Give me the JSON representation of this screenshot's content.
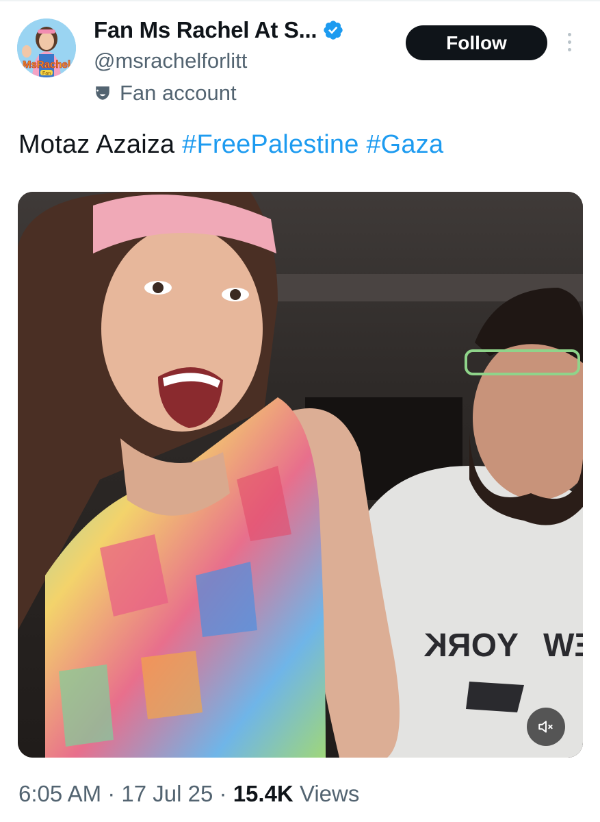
{
  "author": {
    "display_name": "Fan Ms Rachel At S...",
    "handle": "@msrachelforlitt",
    "label": "Fan account",
    "avatar_text": "MsRachel",
    "avatar_subtext": "Fan",
    "verified_color": "#1d9bf0"
  },
  "actions": {
    "follow_label": "Follow",
    "more_icon": "more-vertical-icon"
  },
  "tweet": {
    "text_plain": "Motaz Azaiza ",
    "hashtags": [
      "#FreePalestine",
      "#Gaza"
    ]
  },
  "media": {
    "type": "video",
    "shirt_text_1": "YORK",
    "shirt_text_2": "NEW",
    "mute_icon": "volume-muted-icon"
  },
  "meta": {
    "time": "6:05 AM",
    "separator": "·",
    "date": "17 Jul 25",
    "views_count": "15.4K",
    "views_label": "Views"
  },
  "colors": {
    "accent": "#1d9bf0",
    "text_primary": "#0f1419",
    "text_secondary": "#536471",
    "button_bg": "#0f1419"
  }
}
